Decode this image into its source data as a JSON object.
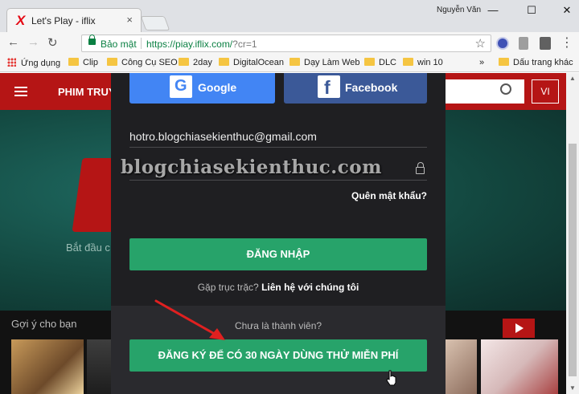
{
  "browser": {
    "tab_title": "Let's Play - iflix",
    "tab_close": "×",
    "user_name": "Nguyễn Văn",
    "window_controls": {
      "minimize": "—",
      "maximize": "☐",
      "close": "✕"
    },
    "nav": {
      "back": "←",
      "forward": "→",
      "reload": "↻"
    },
    "address": {
      "secure_label": "Bảo mật",
      "url_main": "https://piay.iflix.com/",
      "url_query": "?cr=1"
    },
    "star": "☆"
  },
  "bookmarks": {
    "apps": "Ứng dụng",
    "items": [
      "Clip",
      "Công Cụ SEO",
      "2day",
      "DigitalOcean",
      "Dạy Làm Web",
      "DLC",
      "win 10"
    ],
    "overflow": "»",
    "other": "Dấu trang khác"
  },
  "site": {
    "nav_label": "PHIM TRUY",
    "lang": "VI",
    "hero_text": "Bắt đầu c",
    "row_title": "Gợi ý cho bạn"
  },
  "login": {
    "google_label": "Google",
    "facebook_label": "Facebook",
    "email": "hotro.blogchiasekienthuc@gmail.com",
    "watermark": "blogchiasekienthuc.com",
    "forgot": "Quên mật khẩu?",
    "login_button": "ĐĂNG NHẬP",
    "help_prefix": "Gặp trục trặc?",
    "help_link": "Liên hệ với chúng tôi",
    "not_member": "Chưa là thành viên?",
    "signup_button": "ĐĂNG KÝ ĐỂ CÓ 30 NGÀY DÙNG THỬ MIỄN PHÍ"
  },
  "colors": {
    "accent_red": "#b51515",
    "green": "#27a36a",
    "annotation_arrow": "#e02020"
  }
}
